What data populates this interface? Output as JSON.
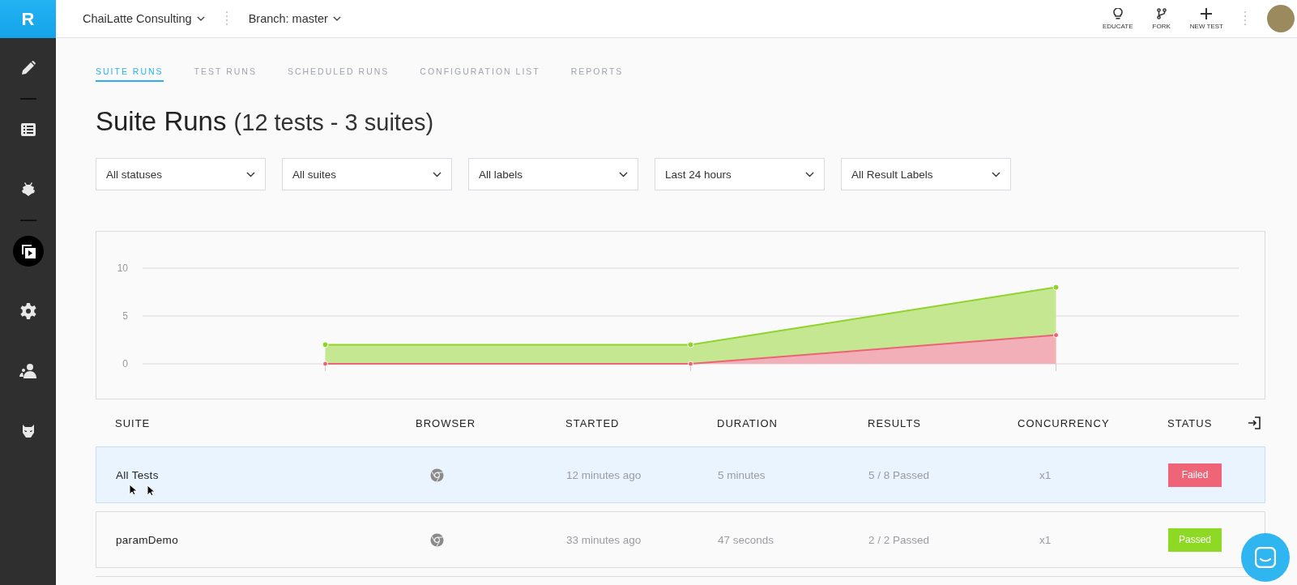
{
  "logo": "R",
  "topbar": {
    "org": "ChaiLatte Consulting",
    "branch": "Branch: master",
    "actions": [
      {
        "kind": "educate",
        "label": "EDUCATE"
      },
      {
        "kind": "fork",
        "label": "FORK"
      },
      {
        "kind": "new",
        "label": "NEW TEST"
      }
    ]
  },
  "sidebar": {
    "items": [
      {
        "kind": "pencil",
        "selected": false
      },
      {
        "kind": "divider"
      },
      {
        "kind": "list",
        "selected": false
      },
      {
        "kind": "bug",
        "selected": false
      },
      {
        "kind": "divider"
      },
      {
        "kind": "runs",
        "selected": true
      },
      {
        "kind": "gear",
        "selected": false
      },
      {
        "kind": "people",
        "selected": false
      },
      {
        "kind": "mask",
        "selected": false
      }
    ]
  },
  "tabs": [
    {
      "label": "SUITE RUNS",
      "selected": true
    },
    {
      "label": "TEST RUNS",
      "selected": false
    },
    {
      "label": "SCHEDULED RUNS",
      "selected": false
    },
    {
      "label": "CONFIGURATION LIST",
      "selected": false
    },
    {
      "label": "REPORTS",
      "selected": false
    }
  ],
  "title": "Suite Runs",
  "subtitle": "(12 tests - 3 suites)",
  "filters": [
    "All statuses",
    "All suites",
    "All labels",
    "Last 24 hours",
    "All Result Labels"
  ],
  "chart_data": {
    "type": "area",
    "categories": [
      null,
      null,
      null
    ],
    "ylim": [
      0,
      10
    ],
    "yticks": [
      0,
      5,
      10
    ],
    "stacked": false,
    "series": [
      {
        "color": "#8fd42a",
        "values": [
          2,
          2,
          8
        ]
      },
      {
        "color": "#ec6473",
        "values": [
          0,
          0,
          3
        ]
      }
    ]
  },
  "table": {
    "columns": [
      "SUITE",
      "BROWSER",
      "STARTED",
      "DURATION",
      "RESULTS",
      "CONCURRENCY",
      "STATUS"
    ],
    "rows": [
      {
        "suite": "All Tests",
        "started": "12 minutes ago",
        "duration": "5 minutes",
        "results": "5 / 8 Passed",
        "concurrency": "x1",
        "status": "Failed",
        "kind": "failed",
        "selected": true
      },
      {
        "suite": "paramDemo",
        "started": "33 minutes ago",
        "duration": "47 seconds",
        "results": "2 / 2 Passed",
        "concurrency": "x1",
        "status": "Passed",
        "kind": "passed",
        "selected": false
      }
    ]
  }
}
